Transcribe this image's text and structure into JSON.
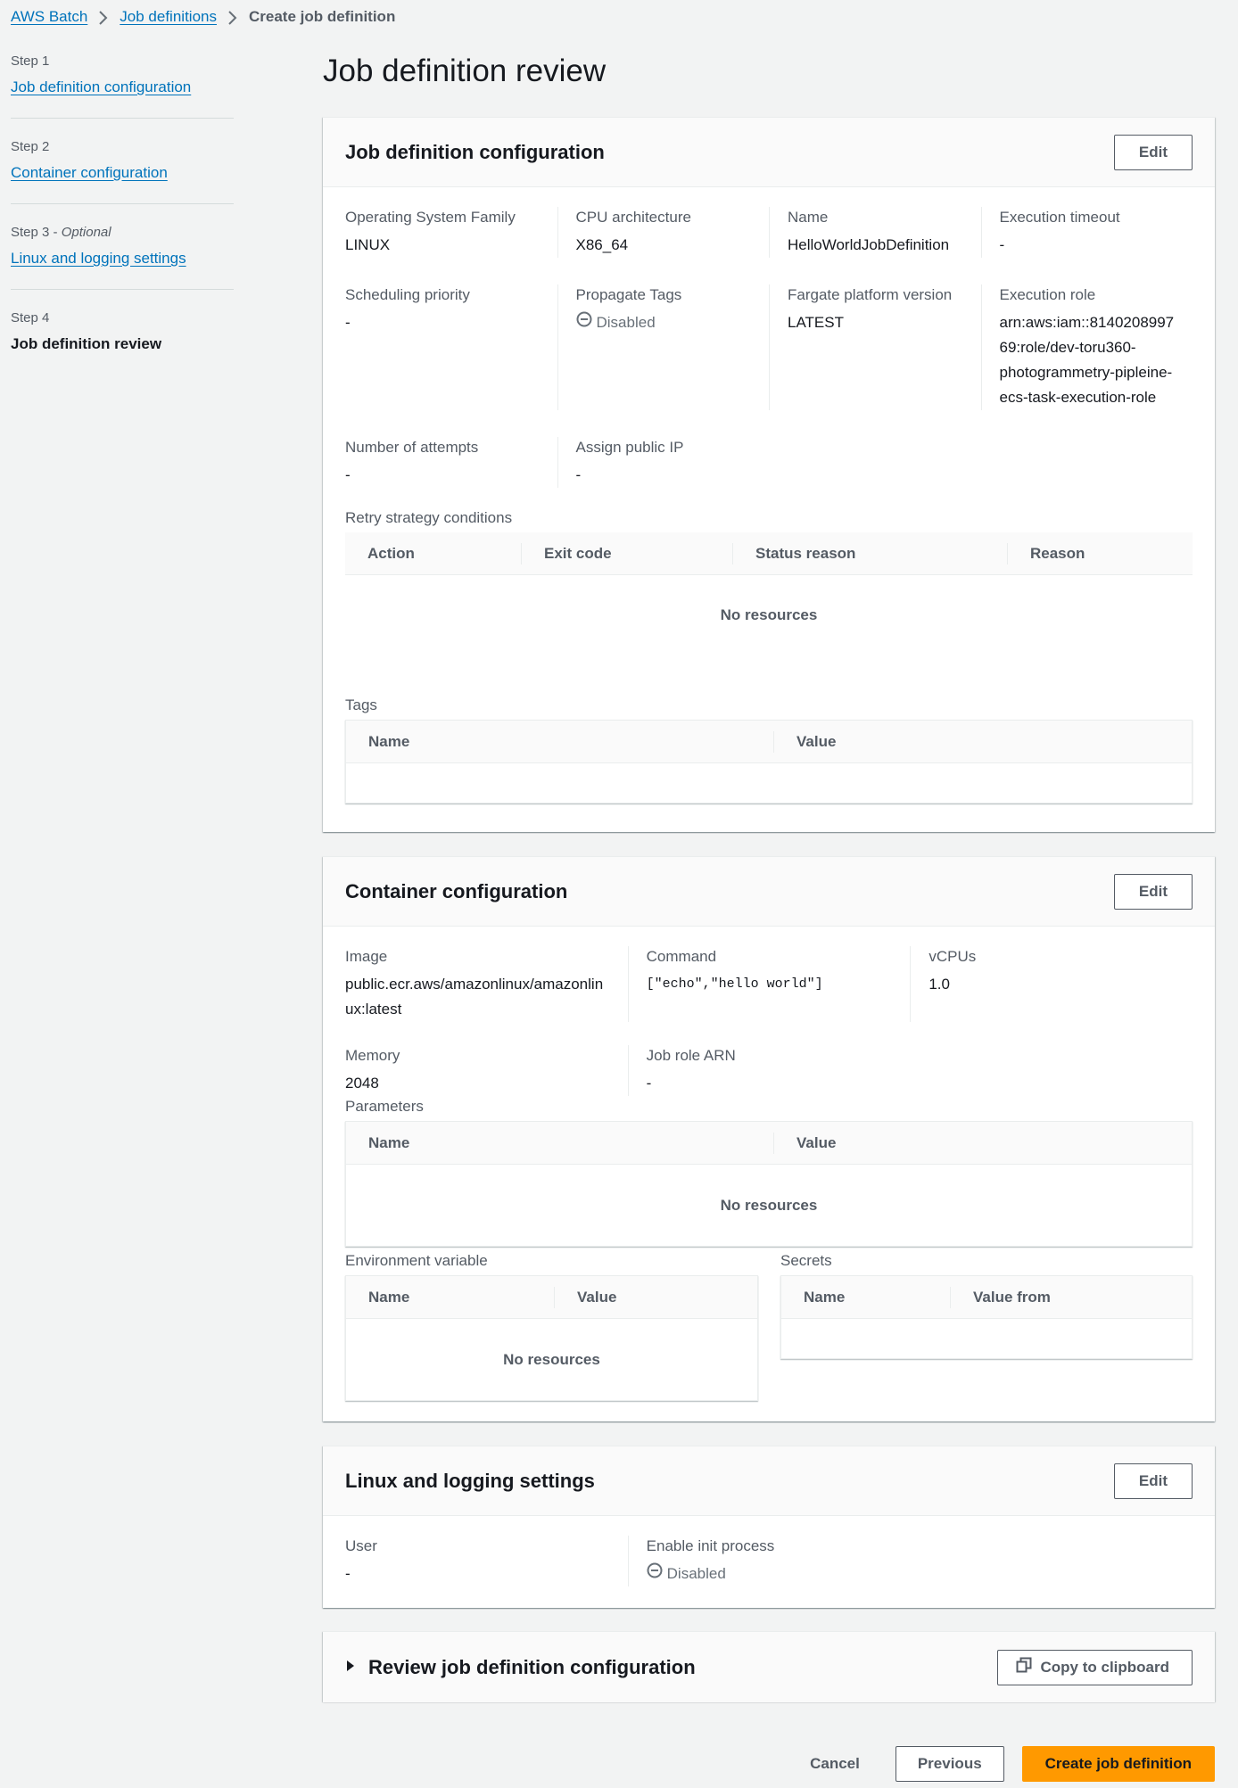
{
  "breadcrumb": {
    "items": [
      {
        "label": "AWS Batch"
      },
      {
        "label": "Job definitions"
      }
    ],
    "current": "Create job definition"
  },
  "steps": [
    {
      "step": "Step 1",
      "optional": "",
      "label": "Job definition configuration",
      "current": false
    },
    {
      "step": "Step 2",
      "optional": "",
      "label": "Container configuration",
      "current": false
    },
    {
      "step": "Step 3",
      "optional": "Optional",
      "label": "Linux and logging settings",
      "current": false
    },
    {
      "step": "Step 4",
      "optional": "",
      "label": "Job definition review",
      "current": true
    }
  ],
  "page_title": "Job definition review",
  "sections": {
    "job_def": {
      "title": "Job definition configuration",
      "edit_label": "Edit",
      "fields": [
        {
          "label": "Operating System Family",
          "value": "LINUX"
        },
        {
          "label": "CPU architecture",
          "value": "X86_64"
        },
        {
          "label": "Name",
          "value": "HelloWorldJobDefinition"
        },
        {
          "label": "Execution timeout",
          "value": "-"
        },
        {
          "label": "Scheduling priority",
          "value": "-"
        },
        {
          "label": "Propagate Tags",
          "value": "Disabled",
          "status": "disabled"
        },
        {
          "label": "Fargate platform version",
          "value": "LATEST"
        },
        {
          "label": "Execution role",
          "value": "arn:aws:iam::814020899769:role/dev-toru360-photogrammetry-pipleine-ecs-task-execution-role"
        },
        {
          "label": "Number of attempts",
          "value": "-"
        },
        {
          "label": "Assign public IP",
          "value": "-"
        }
      ],
      "retry": {
        "label": "Retry strategy conditions",
        "columns": [
          "Action",
          "Exit code",
          "Status reason",
          "Reason"
        ],
        "empty": "No resources"
      },
      "tags": {
        "label": "Tags",
        "columns": [
          "Name",
          "Value"
        ]
      }
    },
    "container": {
      "title": "Container configuration",
      "edit_label": "Edit",
      "fields": [
        {
          "label": "Image",
          "value": "public.ecr.aws/amazonlinux/amazonlinux:latest"
        },
        {
          "label": "Command",
          "value": "[\"echo\",\"hello world\"]"
        },
        {
          "label": "vCPUs",
          "value": "1.0"
        },
        {
          "label": "Memory",
          "value": "2048"
        },
        {
          "label": "Job role ARN",
          "value": "-"
        }
      ],
      "parameters": {
        "label": "Parameters",
        "columns": [
          "Name",
          "Value"
        ],
        "empty": "No resources"
      },
      "env": {
        "label": "Environment variable",
        "columns": [
          "Name",
          "Value"
        ],
        "empty": "No resources"
      },
      "secrets": {
        "label": "Secrets",
        "columns": [
          "Name",
          "Value from"
        ]
      }
    },
    "linux": {
      "title": "Linux and logging settings",
      "edit_label": "Edit",
      "fields": [
        {
          "label": "User",
          "value": "-"
        },
        {
          "label": "Enable init process",
          "value": "Disabled",
          "status": "disabled"
        }
      ]
    },
    "review": {
      "title": "Review job definition configuration",
      "copy_label": "Copy to clipboard"
    }
  },
  "footer": {
    "cancel": "Cancel",
    "previous": "Previous",
    "create": "Create job definition"
  }
}
